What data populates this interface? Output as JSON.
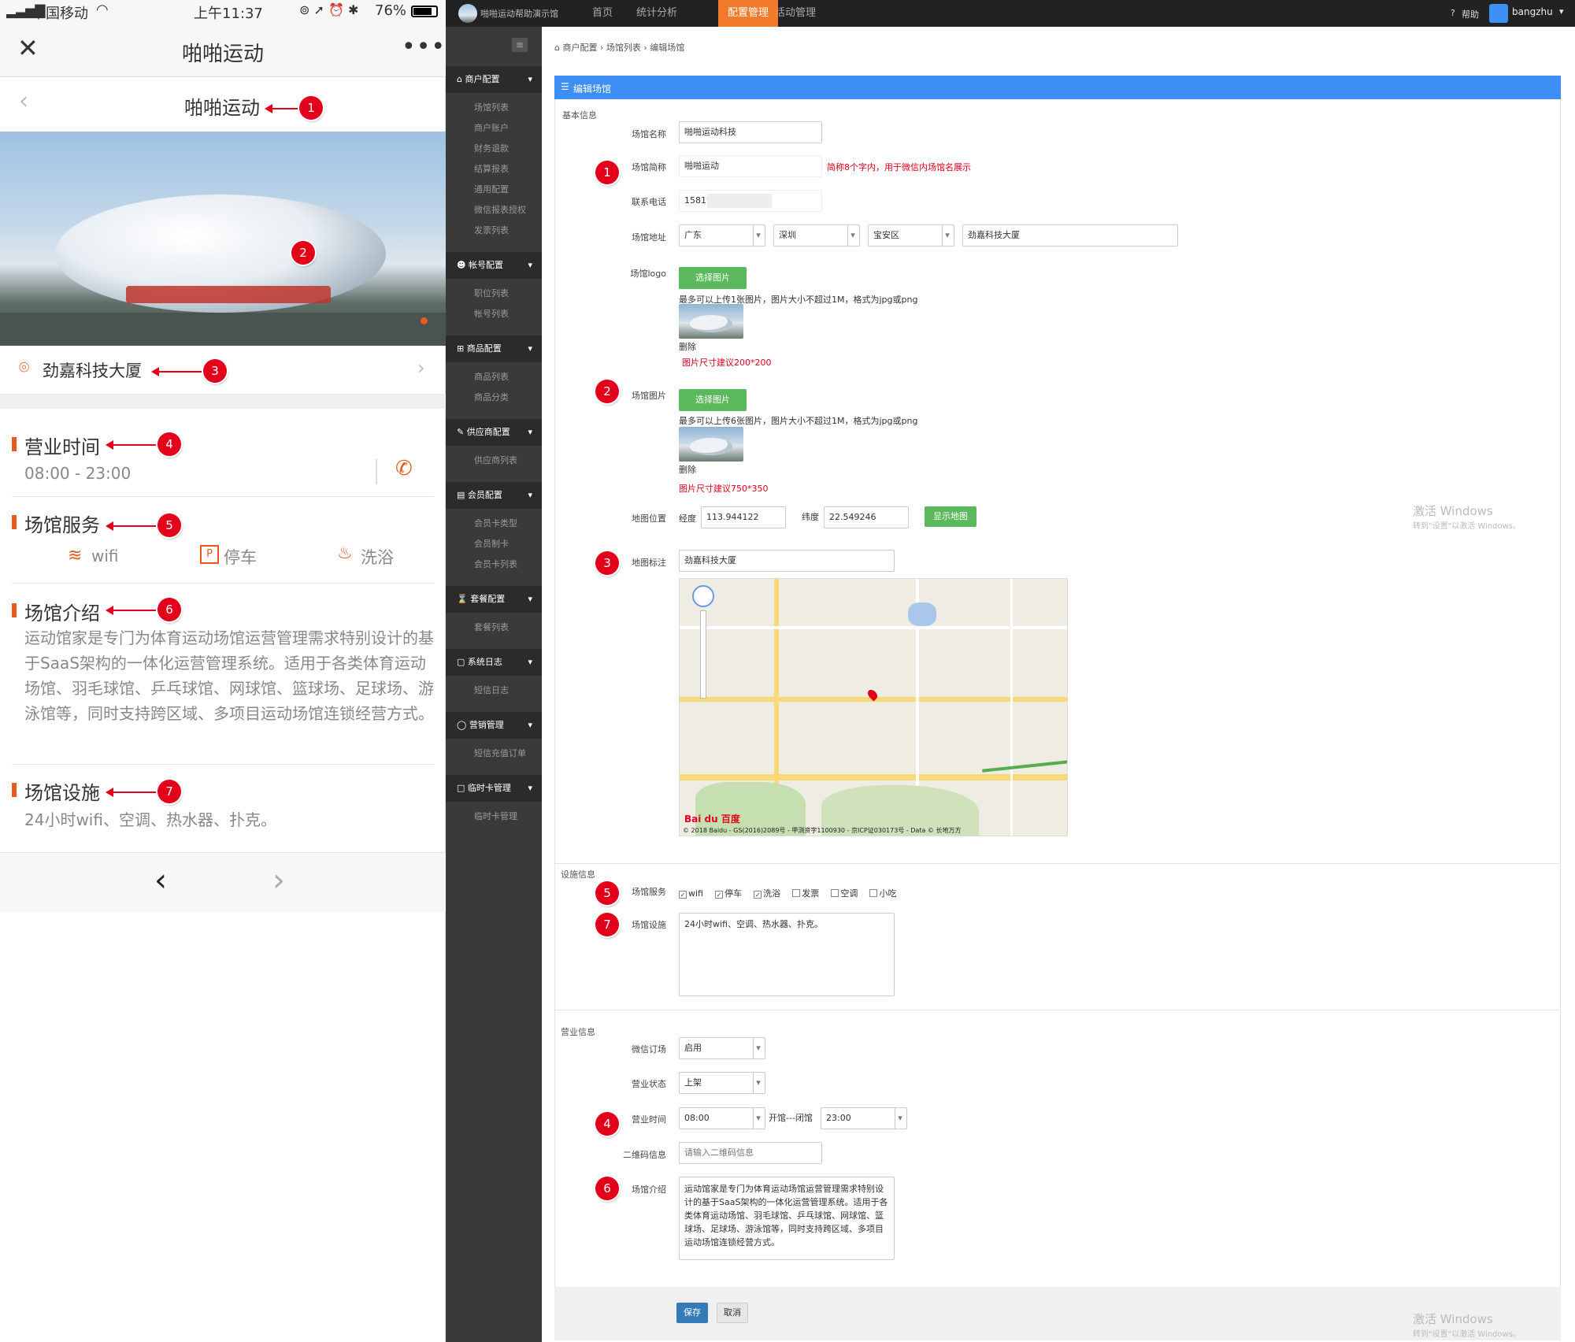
{
  "phone": {
    "status": {
      "carrier": "中国移动",
      "time": "上午11:37",
      "battery": "76%"
    },
    "title": "啪啪运动",
    "page_title": "啪啪运动",
    "location": "劲嘉科技大厦",
    "hours": {
      "title": "营业时间",
      "value": "08:00 - 23:00"
    },
    "services": {
      "title": "场馆服务",
      "items": [
        "wifi",
        "停车",
        "洗浴"
      ]
    },
    "intro": {
      "title": "场馆介绍",
      "text": "运动馆家是专门为体育运动场馆运营管理需求特别设计的基于SaaS架构的一体化运营管理系统。适用于各类体育运动场馆、羽毛球馆、乒乓球馆、网球馆、篮球场、足球场、游泳馆等，同时支持跨区域、多项目运动场馆连锁经营方式。"
    },
    "facilities": {
      "title": "场馆设施",
      "text": "24小时wifi、空调、热水器、扑克。"
    }
  },
  "annotations": [
    "1",
    "2",
    "3",
    "4",
    "5",
    "6",
    "7"
  ],
  "admin": {
    "brand": "啪啪运动帮助演示馆",
    "nav": [
      "首页",
      "统计分析",
      "配置管理",
      "活动管理"
    ],
    "help": "帮助",
    "user": "bangzhu",
    "sidebar": [
      {
        "head": "商户配置",
        "items": [
          "场馆列表",
          "商户账户",
          "财务退款",
          "结算报表",
          "通用配置",
          "微信报表授权",
          "发票列表"
        ]
      },
      {
        "head": "帐号配置",
        "items": [
          "职位列表",
          "帐号列表"
        ]
      },
      {
        "head": "商品配置",
        "items": [
          "商品列表",
          "商品分类"
        ]
      },
      {
        "head": "供应商配置",
        "items": [
          "供应商列表"
        ]
      },
      {
        "head": "会员配置",
        "items": [
          "会员卡类型",
          "会员制卡",
          "会员卡列表"
        ]
      },
      {
        "head": "套餐配置",
        "items": [
          "套餐列表"
        ]
      },
      {
        "head": "系统日志",
        "items": [
          "短信日志"
        ]
      },
      {
        "head": "营销管理",
        "items": [
          "短信充值订单"
        ]
      },
      {
        "head": "临时卡管理",
        "items": [
          "临时卡管理"
        ]
      }
    ],
    "breadcrumb": "商户配置 › 场馆列表 › 编辑场馆",
    "panel_title": "编辑场馆",
    "basic_section": "基本信息",
    "fields": {
      "name_label": "场馆名称",
      "name": "啪啪运动科技",
      "short_label": "场馆简称",
      "short": "啪啪运动",
      "short_hint": "简称8个字内，用于微信内场馆名展示",
      "phone_label": "联系电话",
      "phone": "15819",
      "addr_label": "场馆地址",
      "province": "广东",
      "city": "深圳",
      "district": "宝安区",
      "street": "劲嘉科技大厦",
      "logo_label": "场馆logo",
      "choose": "选择图片",
      "logo_hint": "最多可以上传1张图片，图片大小不超过1M，格式为jpg或png",
      "delete": "删除",
      "logo_size": "图片尺寸建议200*200",
      "img_label": "场馆图片",
      "img_hint": "最多可以上传6张图片，图片大小不超过1M，格式为jpg或png",
      "img_size": "图片尺寸建议750*350",
      "map_label": "地图位置",
      "lng_label": "经度",
      "lng": "113.944122",
      "lat_label": "纬度",
      "lat": "22.549246",
      "show_map": "显示地图",
      "mark_label": "地图标注",
      "mark": "劲嘉科技大厦",
      "map_copyright": "© 2018 Baidu - GS(2016)2089号 - 甲测资字1100930 - 京ICP证030173号 - Data © 长地万方",
      "map_logo": "Bai du 百度"
    },
    "facility_section": "设施信息",
    "service_label": "场馆服务",
    "service_options": [
      {
        "label": "wifi",
        "checked": true
      },
      {
        "label": "停车",
        "checked": true
      },
      {
        "label": "洗浴",
        "checked": true
      },
      {
        "label": "发票",
        "checked": false
      },
      {
        "label": "空调",
        "checked": false
      },
      {
        "label": "小吃",
        "checked": false
      }
    ],
    "facility_label": "场馆设施",
    "facility": "24小时wifi、空调、热水器、扑克。",
    "business_section": "营业信息",
    "wechat_label": "微信订场",
    "wechat": "启用",
    "state_label": "营业状态",
    "state": "上架",
    "hours_label": "营业时间",
    "open": "08:00",
    "between": "开馆---闭馆",
    "close": "23:00",
    "qr_label": "二维码信息",
    "qr_placeholder": "请输入二维码信息",
    "intro_label": "场馆介绍",
    "intro": "运动馆家是专门为体育运动场馆运营管理需求特别设计的基于SaaS架构的一体化运营管理系统。适用于各类体育运动场馆、羽毛球馆、乒乓球馆、网球馆、篮球场、足球场、游泳馆等，同时支持跨区域、多项目运动场馆连锁经营方式。",
    "save": "保存",
    "cancel": "取消",
    "watermark": {
      "title": "激活 Windows",
      "sub": "转到\"设置\"以激活 Windows。"
    }
  },
  "colors": {
    "accent": "#e85a1d",
    "panel": "#3d8ff5",
    "nav_active": "#f27a2a",
    "badge": "#e3001b",
    "green": "#5cb85c",
    "save": "#337ab7"
  }
}
